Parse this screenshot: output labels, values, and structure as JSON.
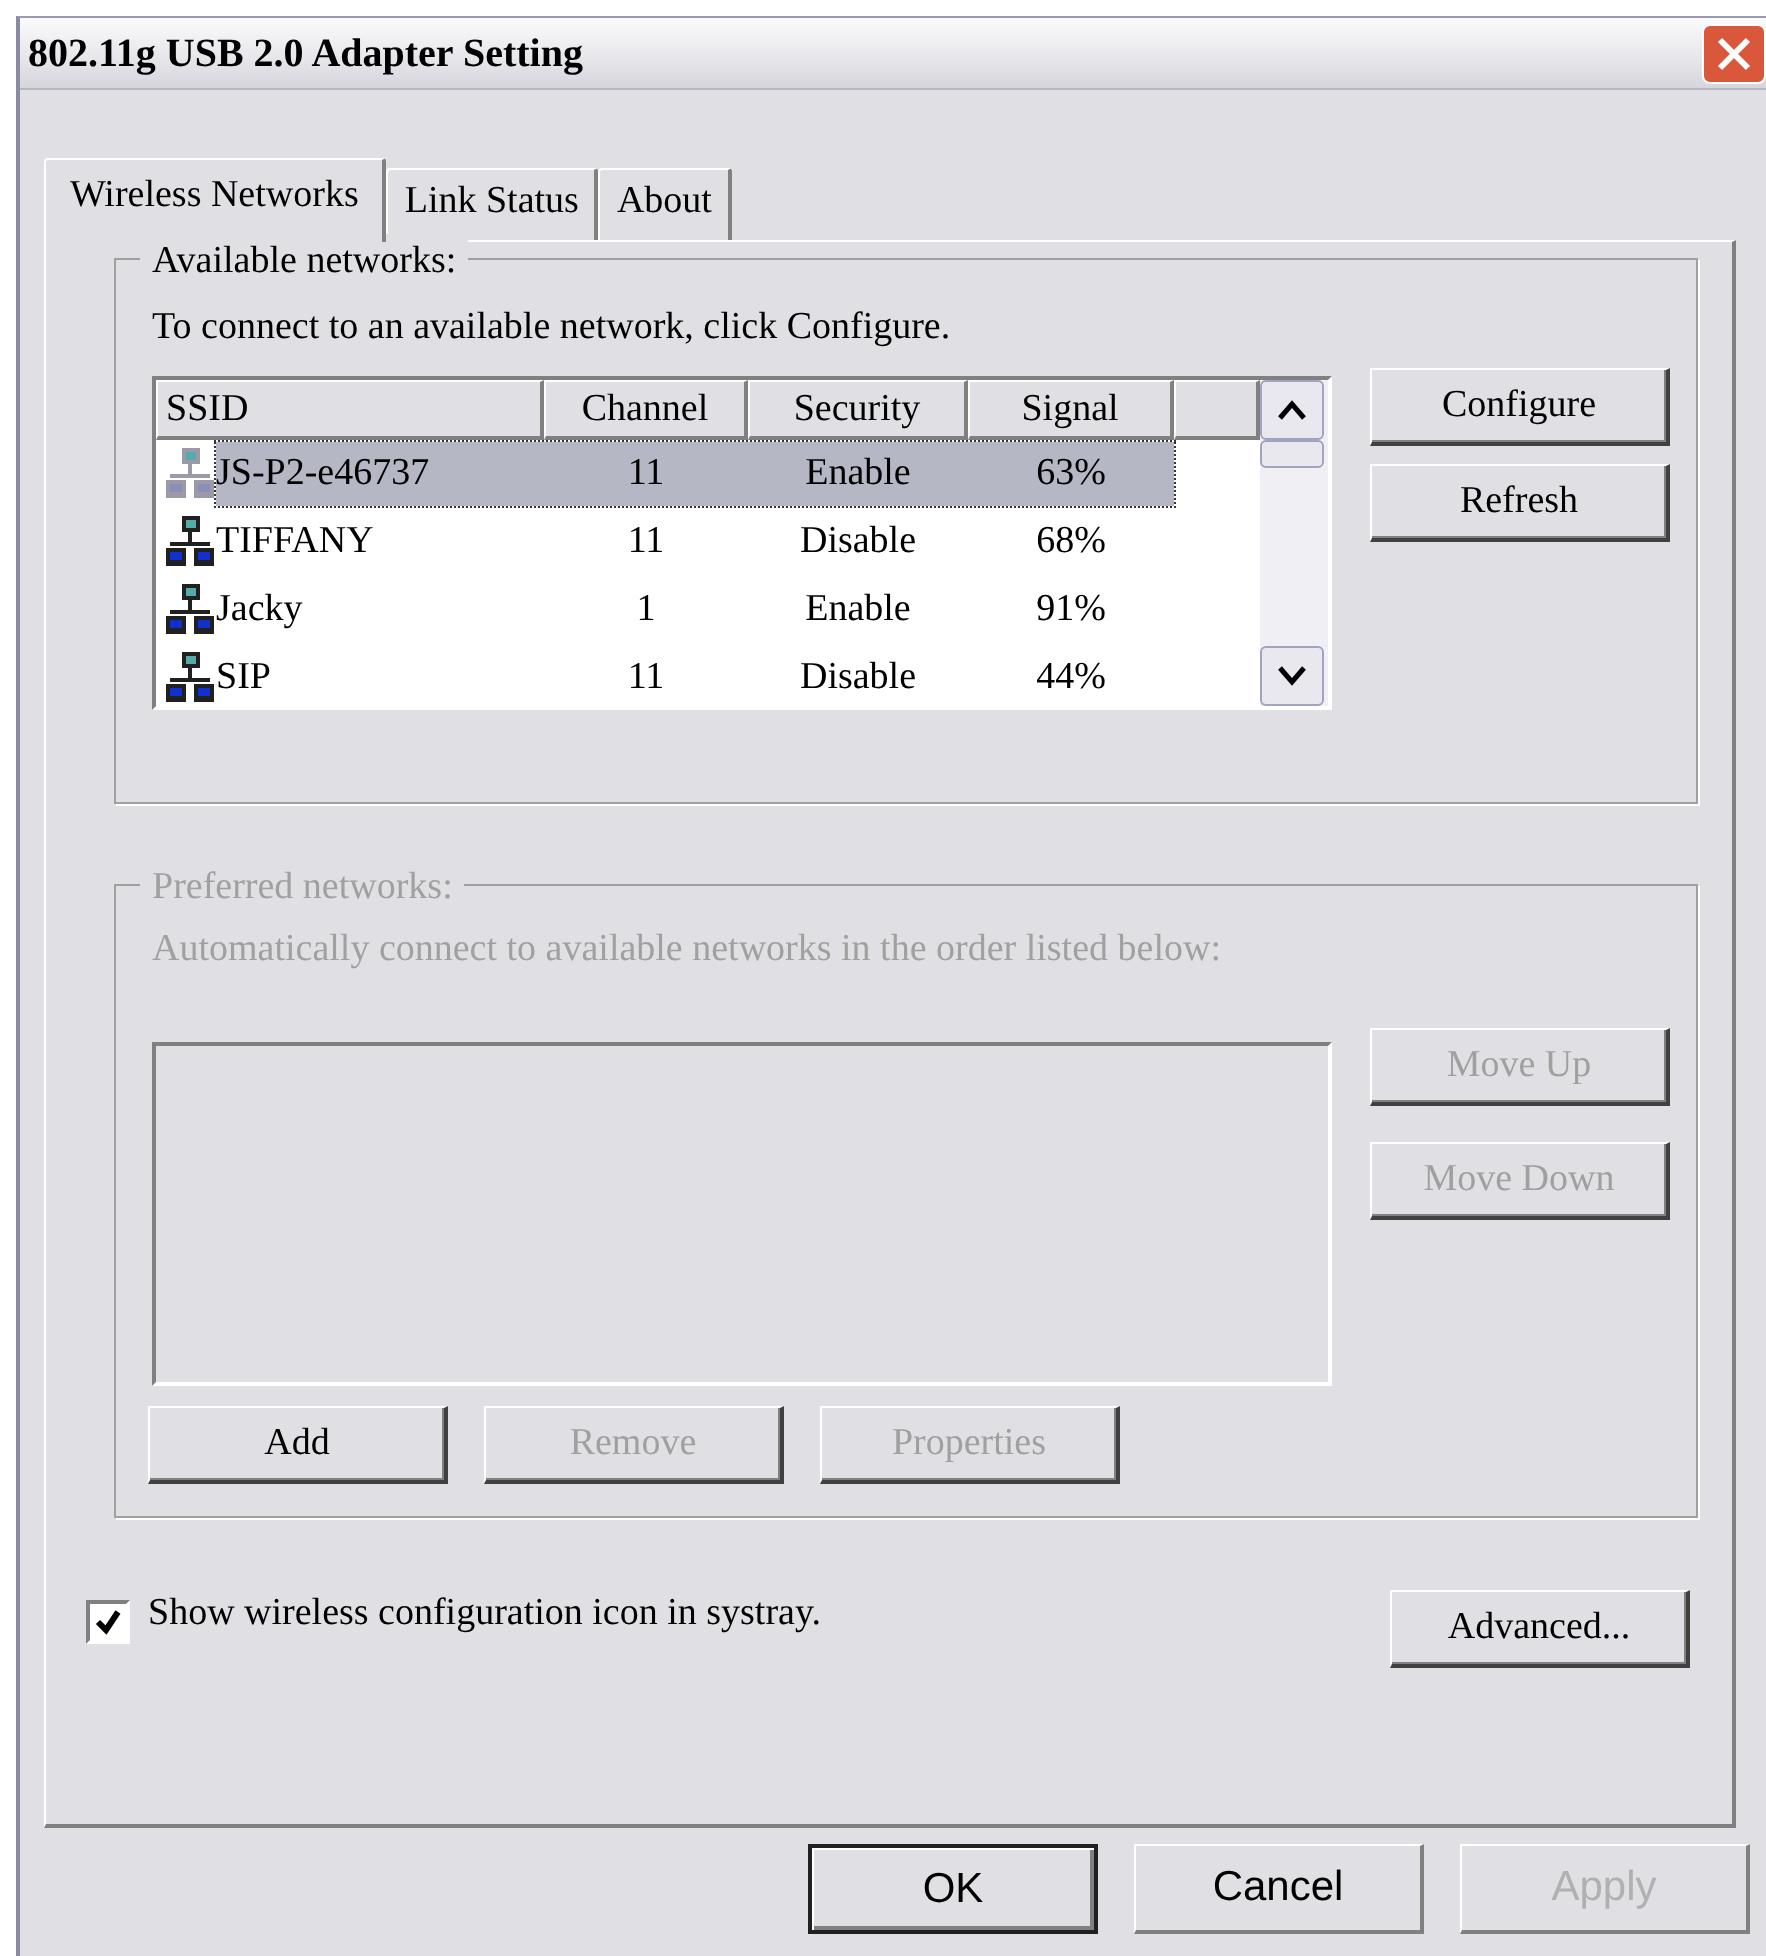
{
  "window": {
    "title": "802.11g USB 2.0 Adapter Setting"
  },
  "tabs": [
    {
      "label": "Wireless Networks",
      "selected": true
    },
    {
      "label": "Link Status",
      "selected": false
    },
    {
      "label": "About",
      "selected": false
    }
  ],
  "available": {
    "title": "Available networks:",
    "description": "To connect to an available network, click Configure.",
    "columns": [
      "SSID",
      "Channel",
      "Security",
      "Signal"
    ],
    "rows": [
      {
        "ssid": "JS-P2-e46737",
        "channel": "11",
        "security": "Enable",
        "signal": "63%",
        "selected": true
      },
      {
        "ssid": "TIFFANY",
        "channel": "11",
        "security": "Disable",
        "signal": "68%",
        "selected": false
      },
      {
        "ssid": "Jacky",
        "channel": "1",
        "security": "Enable",
        "signal": "91%",
        "selected": false
      },
      {
        "ssid": "SIP",
        "channel": "11",
        "security": "Disable",
        "signal": "44%",
        "selected": false
      }
    ],
    "buttons": [
      {
        "label": "Configure",
        "disabled": false
      },
      {
        "label": "Refresh",
        "disabled": false
      }
    ]
  },
  "preferred": {
    "title": "Preferred networks:",
    "disabled": true,
    "description": "Automatically connect to available networks in the order listed below:",
    "side_buttons": [
      {
        "label": "Move Up",
        "disabled": true
      },
      {
        "label": "Move Down",
        "disabled": true
      }
    ],
    "buttons": [
      {
        "label": "Add",
        "disabled": false
      },
      {
        "label": "Remove",
        "disabled": true
      },
      {
        "label": "Properties",
        "disabled": true
      }
    ]
  },
  "systray": {
    "label": "Show wireless configuration icon in systray.",
    "checked": true
  },
  "advanced_button": {
    "label": "Advanced...",
    "disabled": false
  },
  "dialog_buttons": [
    {
      "label": "OK",
      "default": true,
      "disabled": false
    },
    {
      "label": "Cancel",
      "default": false,
      "disabled": false
    },
    {
      "label": "Apply",
      "default": false,
      "disabled": true
    }
  ]
}
